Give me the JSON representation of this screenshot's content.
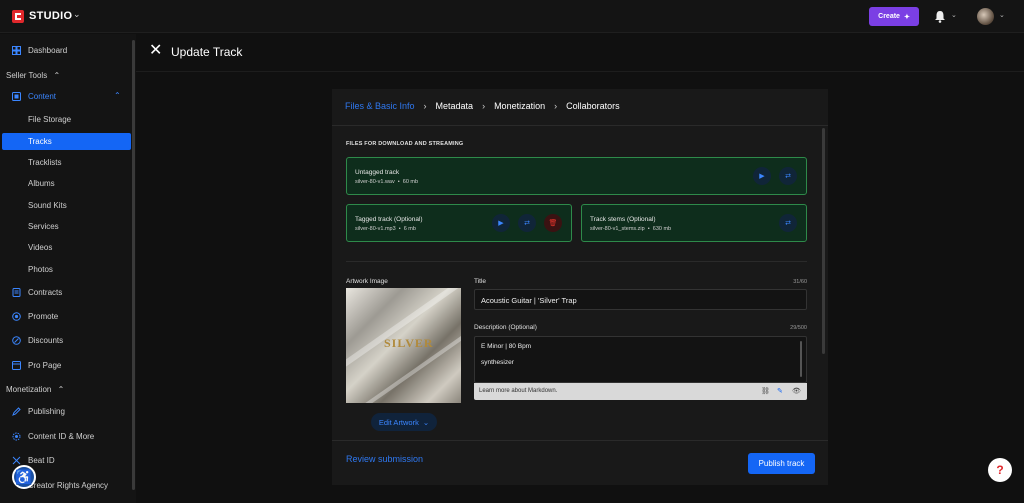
{
  "topbar": {
    "brand": "STUDIO",
    "create_label": "Create"
  },
  "sidebar": {
    "dashboard": "Dashboard",
    "seller_tools": "Seller Tools",
    "content": "Content",
    "content_items": [
      "File Storage",
      "Tracks",
      "Tracklists",
      "Albums",
      "Sound Kits",
      "Services",
      "Videos",
      "Photos"
    ],
    "contracts": "Contracts",
    "promote": "Promote",
    "discounts": "Discounts",
    "pro_page": "Pro Page",
    "monetization": "Monetization",
    "publishing": "Publishing",
    "content_id": "Content ID & More",
    "beat_id": "Beat ID",
    "creator_rights": "Creator Rights Agency"
  },
  "header": {
    "title": "Update Track"
  },
  "steps": [
    "Files & Basic Info",
    "Metadata",
    "Monetization",
    "Collaborators"
  ],
  "files": {
    "heading": "FILES FOR DOWNLOAD AND STREAMING",
    "untagged": {
      "name": "Untagged track",
      "file": "silver-80-v1.wav",
      "size": "60 mb"
    },
    "tagged": {
      "name": "Tagged track (Optional)",
      "file": "silver-80-v1.mp3",
      "size": "6 mb"
    },
    "stems": {
      "name": "Track stems (Optional)",
      "file": "silver-80-v1_stems.zip",
      "size": "630 mb"
    }
  },
  "artwork": {
    "label": "Artwork Image",
    "image_text": "SILVER",
    "edit_label": "Edit Artwork"
  },
  "title_field": {
    "label": "Title",
    "count": "31/60",
    "value": "Acoustic Guitar | 'Silver' Trap"
  },
  "description_field": {
    "label": "Description (Optional)",
    "count": "29/500",
    "lines": [
      "E Minor | 80 Bpm",
      "synthesizer"
    ],
    "markdown_hint": "Learn more about Markdown."
  },
  "footer": {
    "review_label": "Review submission",
    "publish_label": "Publish track"
  },
  "colors": {
    "accent_blue": "#1466f5",
    "create_purple": "#7b3fe4",
    "file_green_border": "#2e8a4a",
    "danger_red": "#e5352c"
  }
}
